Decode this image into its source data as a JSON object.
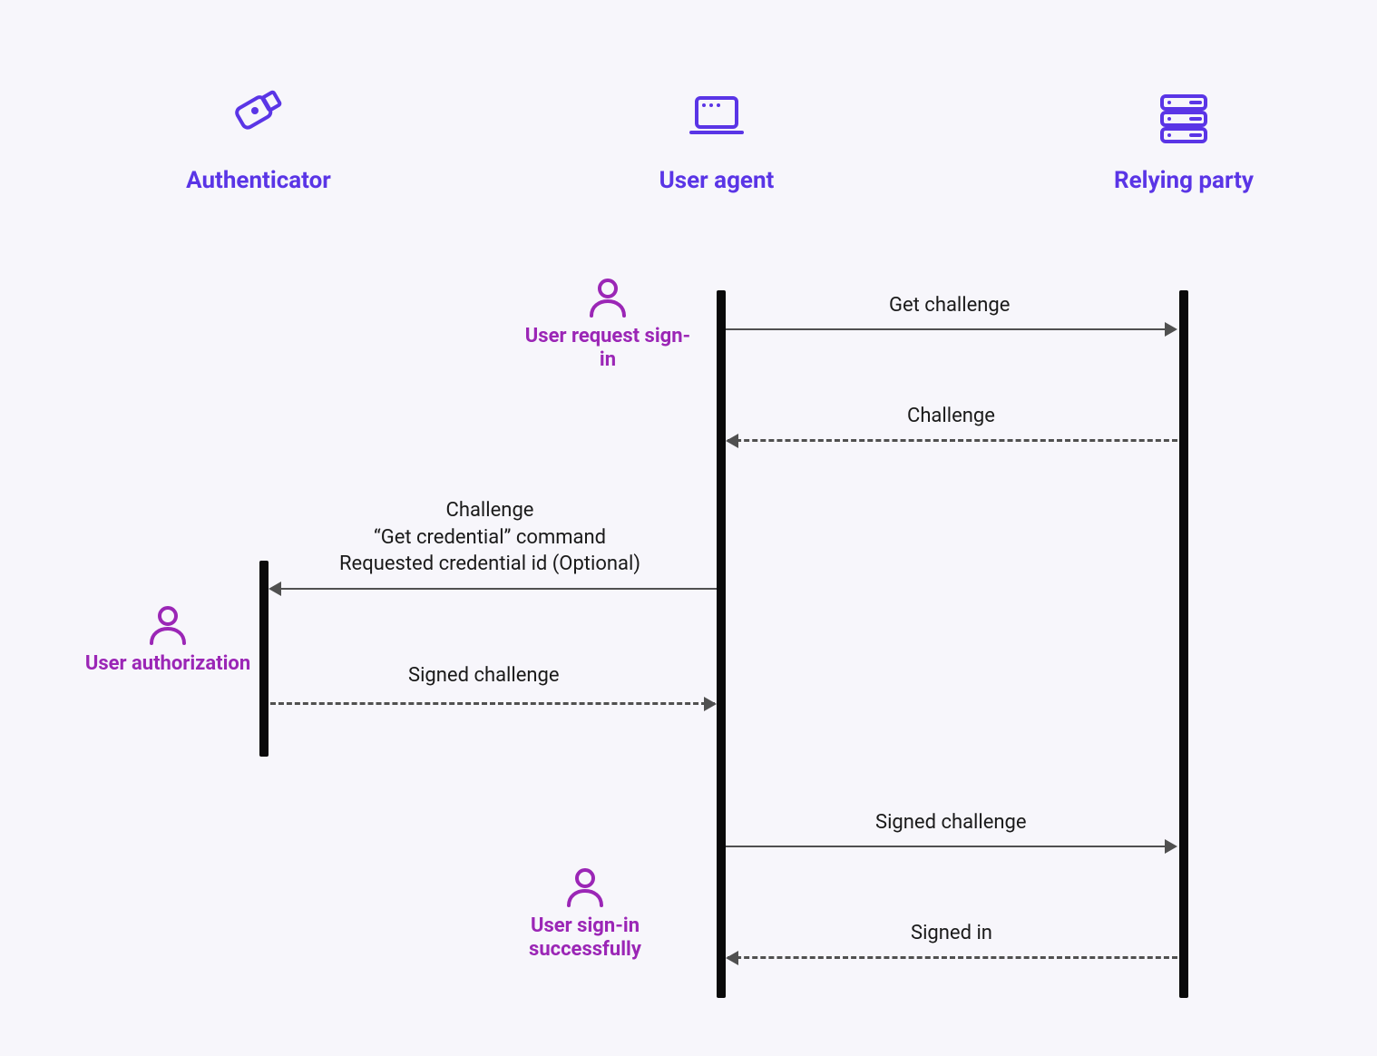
{
  "participants": {
    "authenticator": {
      "label": "Authenticator"
    },
    "user_agent": {
      "label": "User agent"
    },
    "relying_party": {
      "label": "Relying party"
    }
  },
  "events": {
    "request_signin": {
      "label": "User request sign-in"
    },
    "user_auth": {
      "label": "User authorization"
    },
    "signin_success": {
      "label": "User sign-in successfully"
    }
  },
  "messages": {
    "get_challenge": "Get challenge",
    "challenge": "Challenge",
    "get_credential_line1": "Challenge",
    "get_credential_line2": "“Get credential” command",
    "get_credential_line3": "Requested credential id (Optional)",
    "signed_challenge": "Signed challenge",
    "signed_challenge2": "Signed challenge",
    "signed_in": "Signed in"
  },
  "colors": {
    "accent": "#5a35e6",
    "event": "#9b26b6",
    "line": "#505050",
    "bg": "#f7f6fb"
  }
}
